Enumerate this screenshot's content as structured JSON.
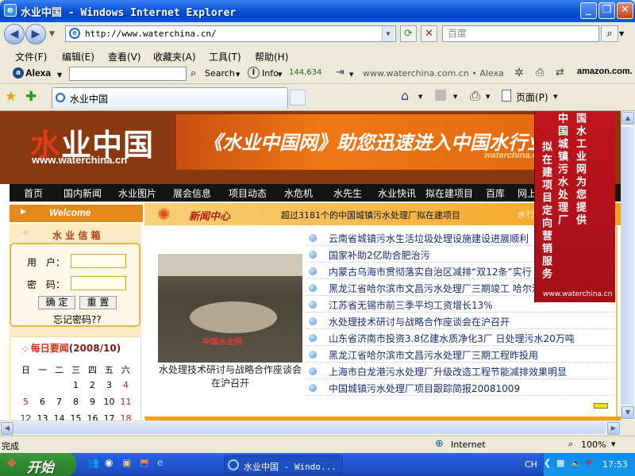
{
  "window": {
    "title": "水业中国 - Windows Internet Explorer"
  },
  "addressbar": {
    "url": "http://www.waterchina.cn/",
    "search_placeholder": "百度"
  },
  "menubar": {
    "items": [
      "文件(F)",
      "编辑(E)",
      "查看(V)",
      "收藏夹(A)",
      "工具(T)",
      "帮助(H)"
    ]
  },
  "alexa": {
    "logo": "Alexa",
    "search_label": "Search",
    "info_label": "Info",
    "rank": "144,634",
    "site": "www.waterchina.com.cn",
    "site_suffix": "Alexa",
    "amazon": "amazon.com."
  },
  "tabs": {
    "active": "水业中国",
    "page_label": "页面(P)"
  },
  "site": {
    "logo_zh_1": "水",
    "logo_zh_2": "业中国",
    "logo_url": "www.waterchina.cn",
    "banner_text": "《水业中国网》助您迅速进入中国水行业",
    "banner_url": "waterchina.cn",
    "nav": [
      "首页",
      "国内新闻",
      "水业图片",
      "展会信息",
      "项目动态",
      "水危机",
      "水先生",
      "水业快讯",
      "拟在建项目",
      "百库",
      "网上"
    ],
    "welcome": "Welcome",
    "news_center": "新闻中心",
    "ticker": "超过3181个的中国城镇污水处理厂拟在建项目",
    "news_more": "水行",
    "login": {
      "title": "水 业 信 箱",
      "user_label": "用　户：",
      "pass_label": "密　码：",
      "ok": "确 定",
      "reset": "重 置",
      "forgot": "忘记密码??"
    },
    "calendar": {
      "title": "每日要闻",
      "date": "(2008/10)",
      "weekdays": [
        "日",
        "一",
        "二",
        "三",
        "四",
        "五",
        "六"
      ],
      "rows": [
        [
          "",
          "",
          "",
          "1",
          "2",
          "3",
          "4"
        ],
        [
          "5",
          "6",
          "7",
          "8",
          "9",
          "10",
          "11"
        ],
        [
          "12",
          "13",
          "14",
          "15",
          "16",
          "17",
          "18"
        ]
      ]
    },
    "photo_watermark": "中国水业网",
    "photo_caption": "水处理技术研讨与战略合作座谈会在沪召开",
    "news": [
      "云南省城镇污水生活垃圾处理设施建设进展顺利",
      "国家补助2亿助合肥治污",
      "内蒙古乌海市贯彻落实自治区减排“双12条”实行",
      "黑龙江省哈尔滨市文昌污水处理厂三期竣工 哈尔滨",
      "江苏省无锡市前三季平均工资增长13%",
      "水处理技术研讨与战略合作座谈会在沪召开",
      "山东省济南市投资3.8亿建水质净化3厂 日处理污水20万吨",
      "黑龙江省哈尔滨市文昌污水处理厂三期工程昨投用",
      "上海市白龙港污水处理厂升级改造工程节能减排效果明显",
      "中国城镇污水处理厂项目跟踪简报20081009"
    ],
    "float_ad": {
      "col1": "国水工业网为您提供",
      "col2": "中国城镇污水处理厂",
      "col3": "拟在建项目定向营销服务",
      "url": "www.waterchina.cn"
    }
  },
  "statusbar": {
    "left": "完成",
    "zone": "Internet",
    "zoom": "100%"
  },
  "taskbar": {
    "start": "开始",
    "task": "水业中国 - Windo...",
    "lang": "CH",
    "time": "17:53"
  },
  "colors": {
    "banner_brown": "#8a3810",
    "accent_orange": "#f07814",
    "nav_black": "#141414",
    "float_red": "#c0141c",
    "link_blue": "#1a2a7a"
  }
}
